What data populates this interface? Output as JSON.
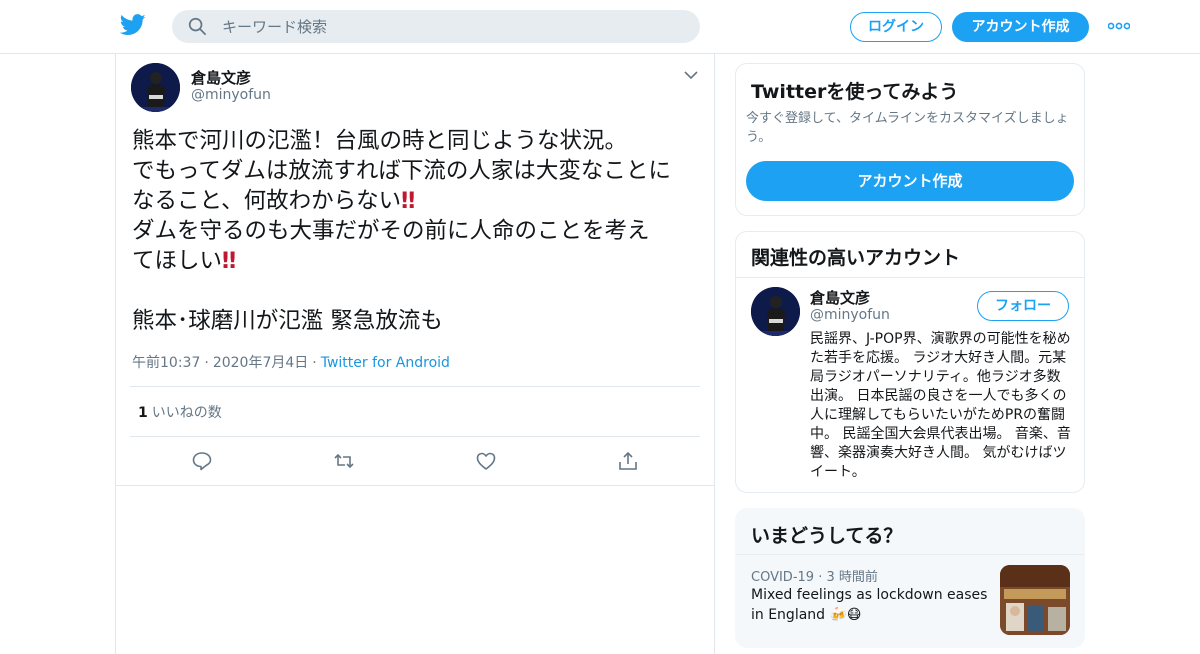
{
  "colors": {
    "accent": "#1da1f2",
    "link": "#1b95e0",
    "muted": "#657786",
    "text": "#14171a",
    "emoji_red": "#be1931"
  },
  "header": {
    "search_placeholder": "キーワード検索",
    "login_label": "ログイン",
    "signup_label": "アカウント作成"
  },
  "tweet": {
    "author_name": "倉島文彦",
    "author_handle": "@minyofun",
    "line1": "熊本で河川の氾濫！台風の時と同じような状況。",
    "line2": "でもってダムは放流すれば下流の人家は大変なことに",
    "line3": "なること、何故わからない",
    "line4": "ダムを守るのも大事だがその前に人命のことを考え",
    "line5": "てほしい",
    "line6": "熊本･球磨川が氾濫 緊急放流も",
    "emoji": "‼",
    "time": "午前10:37",
    "date": "2020年7月4日",
    "source": "Twitter for Android",
    "likes_count": "1",
    "likes_label": "いいねの数"
  },
  "signup_card": {
    "title": "Twitterを使ってみよう",
    "subtitle": "今すぐ登録して、タイムラインをカスタマイズしましょう。",
    "button_label": "アカウント作成"
  },
  "related_card": {
    "title": "関連性の高いアカウント",
    "name": "倉島文彦",
    "handle": "@minyofun",
    "follow_label": "フォロー",
    "bio": "民謡界、J-POP界、演歌界の可能性を秘めた若手を応援。 ラジオ大好き人間。元某局ラジオパーソナリティ。他ラジオ多数出演。 日本民謡の良さを一人でも多くの人に理解してもらいたいがためPRの奮闘中。 民謡全国大会県代表出場。 音楽、音響、楽器演奏大好き人間。 気がむけばツイート。"
  },
  "trends_card": {
    "title": "いまどうしてる？",
    "category": "COVID-19",
    "time": "3 時間前",
    "headline": "Mixed feelings as lockdown eases in England 🍻😷"
  }
}
